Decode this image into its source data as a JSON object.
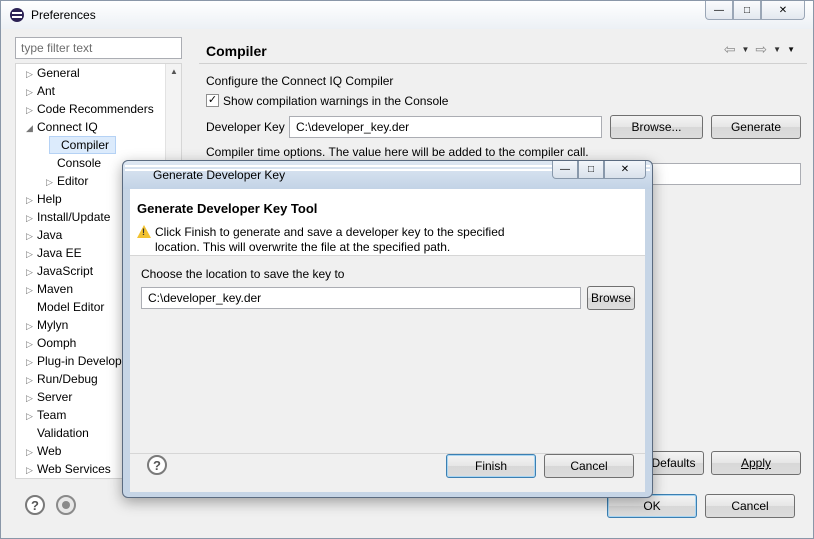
{
  "window": {
    "title": "Preferences"
  },
  "filter": {
    "placeholder": "type filter text"
  },
  "tree": [
    {
      "label": "General",
      "level": 0,
      "expander": "collapsed"
    },
    {
      "label": "Ant",
      "level": 0,
      "expander": "collapsed"
    },
    {
      "label": "Code Recommenders",
      "level": 0,
      "expander": "collapsed"
    },
    {
      "label": "Connect IQ",
      "level": 0,
      "expander": "expanded"
    },
    {
      "label": "Compiler",
      "level": 1,
      "expander": "none",
      "selected": true
    },
    {
      "label": "Console",
      "level": 1,
      "expander": "none"
    },
    {
      "label": "Editor",
      "level": 1,
      "expander": "collapsed"
    },
    {
      "label": "Help",
      "level": 0,
      "expander": "collapsed"
    },
    {
      "label": "Install/Update",
      "level": 0,
      "expander": "collapsed"
    },
    {
      "label": "Java",
      "level": 0,
      "expander": "collapsed"
    },
    {
      "label": "Java EE",
      "level": 0,
      "expander": "collapsed"
    },
    {
      "label": "JavaScript",
      "level": 0,
      "expander": "collapsed"
    },
    {
      "label": "Maven",
      "level": 0,
      "expander": "collapsed"
    },
    {
      "label": "Model Editor",
      "level": 0,
      "expander": "none"
    },
    {
      "label": "Mylyn",
      "level": 0,
      "expander": "collapsed"
    },
    {
      "label": "Oomph",
      "level": 0,
      "expander": "collapsed"
    },
    {
      "label": "Plug-in Develop",
      "level": 0,
      "expander": "collapsed"
    },
    {
      "label": "Run/Debug",
      "level": 0,
      "expander": "collapsed"
    },
    {
      "label": "Server",
      "level": 0,
      "expander": "collapsed"
    },
    {
      "label": "Team",
      "level": 0,
      "expander": "collapsed"
    },
    {
      "label": "Validation",
      "level": 0,
      "expander": "none"
    },
    {
      "label": "Web",
      "level": 0,
      "expander": "collapsed"
    },
    {
      "label": "Web Services",
      "level": 0,
      "expander": "collapsed"
    }
  ],
  "page": {
    "title": "Compiler",
    "section_label": "Configure the Connect IQ Compiler",
    "show_warnings_label": "Show compilation warnings in the Console",
    "show_warnings_checked": true,
    "dev_key_label": "Developer Key",
    "dev_key_value": "C:\\developer_key.der",
    "browse_label": "Browse...",
    "generate_label": "Generate",
    "compiler_options_label": "Compiler time options. The value here will be added to the compiler call.",
    "compiler_options_value": "",
    "restore_defaults_label": "Defaults",
    "apply_label": "Apply"
  },
  "footer": {
    "ok_label": "OK",
    "cancel_label": "Cancel"
  },
  "dialog": {
    "title": "Generate Developer Key",
    "header_title": "Generate Developer Key Tool",
    "message": "Click Finish to generate and save a developer key to the specified location. This will overwrite the file at the specified path.",
    "location_label": "Choose the location to save the key to",
    "location_value": "C:\\developer_key.der",
    "browse_label": "Browse",
    "finish_label": "Finish",
    "cancel_label": "Cancel"
  }
}
